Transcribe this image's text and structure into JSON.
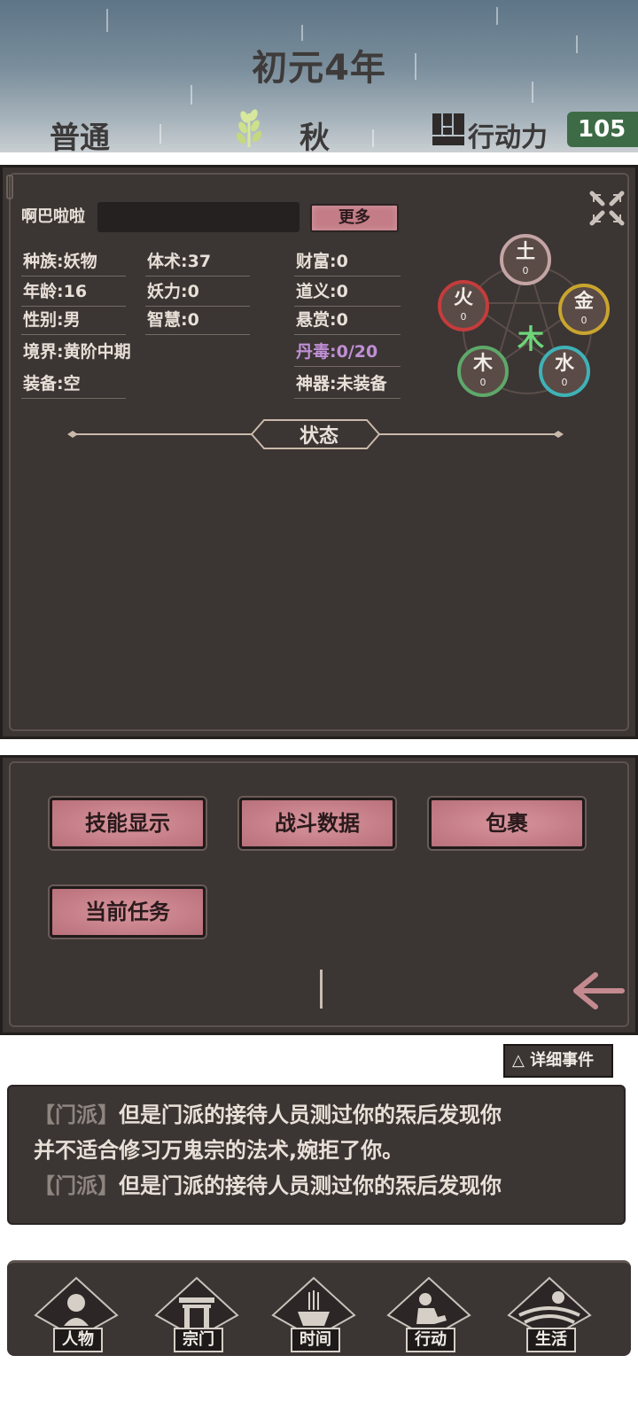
{
  "header": {
    "year": "初元4年",
    "difficulty": "普通",
    "season": "秋",
    "action_label": "行动力",
    "action_value": "105"
  },
  "character": {
    "name": "啊巴啦啦",
    "more_label": "更多",
    "stats": {
      "race": "种族:妖物",
      "age": "年龄:16",
      "gender": "性别:男",
      "realm": "境界:黄阶中期",
      "equipment": "装备:空",
      "body_art": "体术:37",
      "demon_power": "妖力:0",
      "wisdom": "智慧:0",
      "wealth": "财富:0",
      "righteousness": "道义:0",
      "bounty": "悬赏:0",
      "pill_poison": "丹毒:0/20",
      "artifact": "神器:未装备"
    },
    "elements": {
      "earth": {
        "name": "土",
        "value": "0",
        "color": "#c4a4a4"
      },
      "metal": {
        "name": "金",
        "value": "0",
        "color": "#c9a52e"
      },
      "water": {
        "name": "水",
        "value": "0",
        "color": "#3fb2b7"
      },
      "wood": {
        "name": "木",
        "value": "0",
        "color": "#5ea86a"
      },
      "fire": {
        "name": "火",
        "value": "0",
        "color": "#c43c3c"
      },
      "center": "木"
    },
    "status_label": "状态"
  },
  "buttons": {
    "skills": "技能显示",
    "battle_data": "战斗数据",
    "bag": "包裹",
    "current_task": "当前任务"
  },
  "events": {
    "detail_label": "△ 详细事件",
    "lines": [
      {
        "tag": "【门派】",
        "text": "但是门派的接待人员测过你的炁后发现你"
      },
      {
        "tag": "",
        "text": "并不适合修习万鬼宗的法术,婉拒了你。"
      },
      {
        "tag": "【门派】",
        "text": "但是门派的接待人员测过你的炁后发现你"
      }
    ]
  },
  "nav": {
    "character": "人物",
    "sect": "宗门",
    "time": "时间",
    "action": "行动",
    "life": "生活"
  }
}
